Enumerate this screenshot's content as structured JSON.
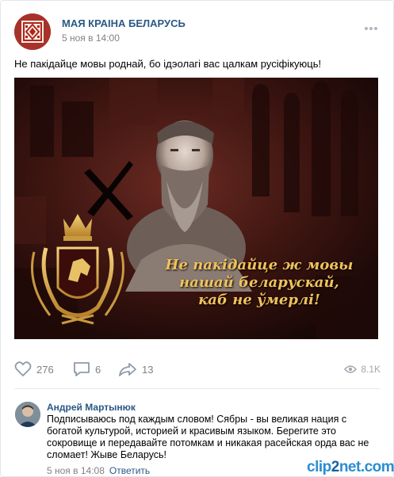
{
  "post": {
    "author": "МАЯ КРАІНА БЕЛАРУСЬ",
    "date": "5 ноя в 14:00",
    "text": "Не пакідайце мовы роднай, бо ідэолагі вас цалкам русіфікуюць!",
    "image_caption_lines": [
      "Не пакідайце ж мовы",
      "нашай беларускай,",
      "каб не ўмерлі!"
    ]
  },
  "actions": {
    "likes": "276",
    "comments": "6",
    "shares": "13",
    "views": "8.1K"
  },
  "comment": {
    "author": "Андрей Мартынюк",
    "text": "Подписываюсь под каждым словом! Сябры - вы великая нация с богатой культурой, историей и красивым языком. Берегите это сокровище и передавайте потомкам и никакая расейская орда вас не сломает! Жыве Беларусь!",
    "date": "5 ноя в 14:08",
    "reply_label": "Ответить"
  },
  "watermark": {
    "left": "clip",
    "accent": "2",
    "right": "net.com"
  },
  "icons": [
    "more-icon",
    "heart-icon",
    "comment-icon",
    "share-icon",
    "eye-icon"
  ],
  "colors": {
    "link": "#2a5885",
    "muted": "#828282",
    "caption_gold": "#f0c25a",
    "photo_dark_red": "#2a0f0c"
  }
}
